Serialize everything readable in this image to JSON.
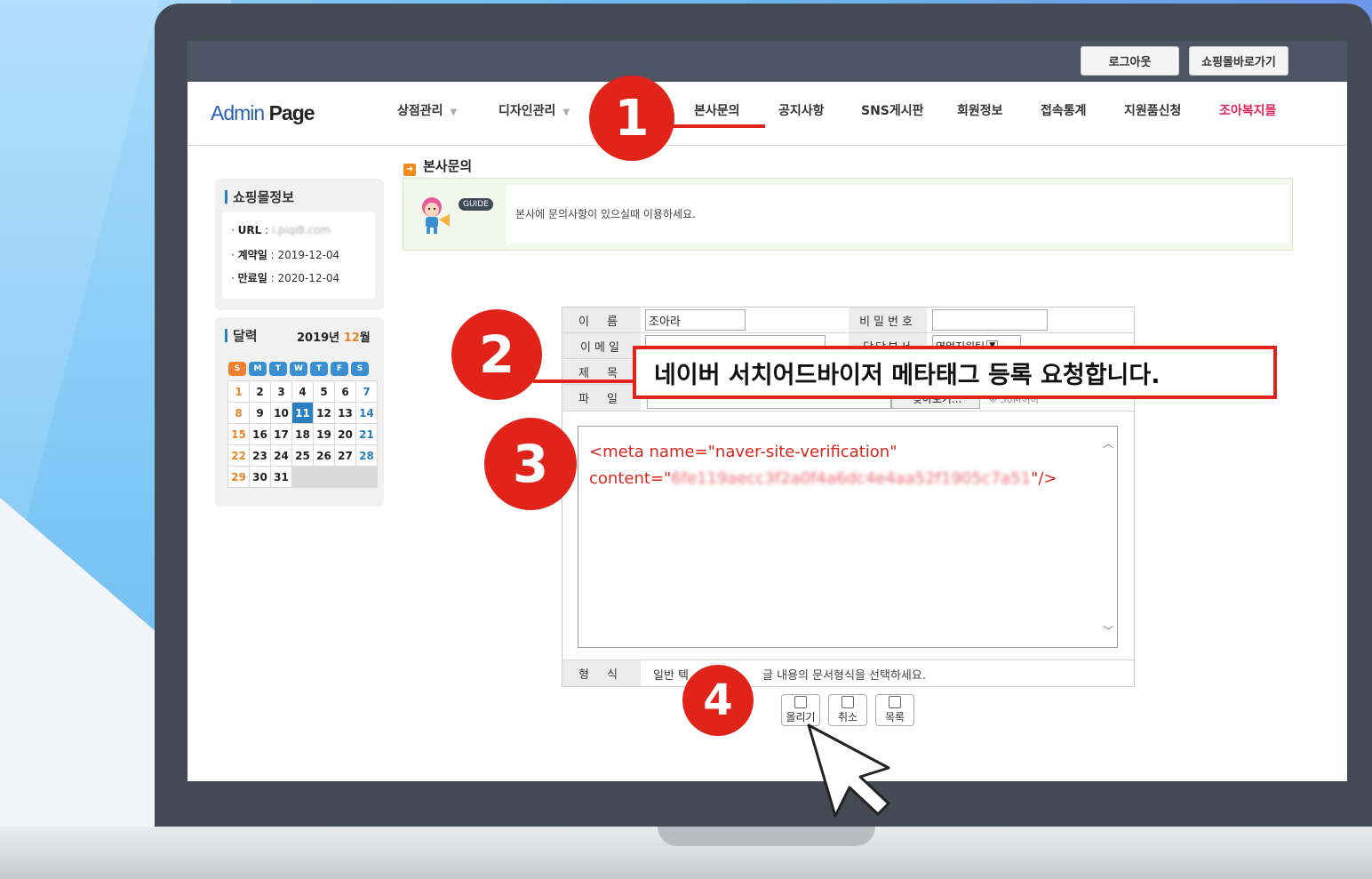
{
  "top_bar": {
    "logout": "로그아웃",
    "mall_link": "쇼핑몰바로가기"
  },
  "logo": {
    "admin": "Admin",
    "page": "Page"
  },
  "nav": [
    {
      "label": "상점관리",
      "has_caret": true
    },
    {
      "label": "디자인관리",
      "has_caret": true
    },
    {
      "label": "본사문의"
    },
    {
      "label": "공지사항"
    },
    {
      "label": "SNS게시판"
    },
    {
      "label": "회원정보"
    },
    {
      "label": "접속통계"
    },
    {
      "label": "지원품신청"
    },
    {
      "label": "조아복지몰",
      "color": "#e0245e"
    }
  ],
  "sidebar": {
    "shop_info": {
      "title": "쇼핑몰정보",
      "url_label": "URL",
      "url_value": "i.piqi8.com",
      "contract_label": "계약일",
      "contract_date": "2019-12-04",
      "expire_label": "만료일",
      "expire_date": "2020-12-04"
    },
    "calendar": {
      "title": "달력",
      "year": "2019년",
      "month": "12",
      "month_suffix": "월",
      "weekdays": [
        "S",
        "M",
        "T",
        "W",
        "T",
        "F",
        "S"
      ],
      "weeks": [
        [
          "1",
          "2",
          "3",
          "4",
          "5",
          "6",
          "7"
        ],
        [
          "8",
          "9",
          "10",
          "11",
          "12",
          "13",
          "14"
        ],
        [
          "15",
          "16",
          "17",
          "18",
          "19",
          "20",
          "21"
        ],
        [
          "22",
          "23",
          "24",
          "25",
          "26",
          "27",
          "28"
        ],
        [
          "29",
          "30",
          "31",
          "",
          "",
          "",
          ""
        ]
      ],
      "today": "11"
    }
  },
  "content": {
    "section_title": "본사문의",
    "guide_badge": "GUIDE",
    "guide_text": "본사에 문의사항이 있으실때 이용하세요."
  },
  "form": {
    "name_label": "이 름",
    "name_value": "조아라",
    "password_label": "비밀번호",
    "email_label": "이메일",
    "dept_label": "담당부서",
    "dept_value": "영업지원팀",
    "subject_label": "제 목",
    "file_label": "파 일",
    "browse_label": "찾아보기...",
    "file_note": "※ 50M이하",
    "body_line1": "<meta name=\"naver-site-verification\"",
    "body_line2_prefix": "content=\"",
    "body_line2_blur": "6fe119aecc3f2a0f4a6dc4e4aa52f1905c7a51",
    "body_line2_suffix": "\"/>",
    "format_label": "형 식",
    "format_value": "일반 텍",
    "format_hint": "글 내용의 문서형식을 선택하세요.",
    "buttons": {
      "upload": "올리기",
      "cancel": "취소",
      "list": "목록"
    }
  },
  "annotations": {
    "step1": "1",
    "step2": "2",
    "step3": "3",
    "step4": "4",
    "subject_callout": "네이버 서치어드바이저 메타태그 등록 요청합니다."
  },
  "colors": {
    "accent_red": "#e2231a",
    "topbar": "#4c5563",
    "link_blue": "#2a7fc1",
    "sunday_orange": "#e8852a"
  }
}
